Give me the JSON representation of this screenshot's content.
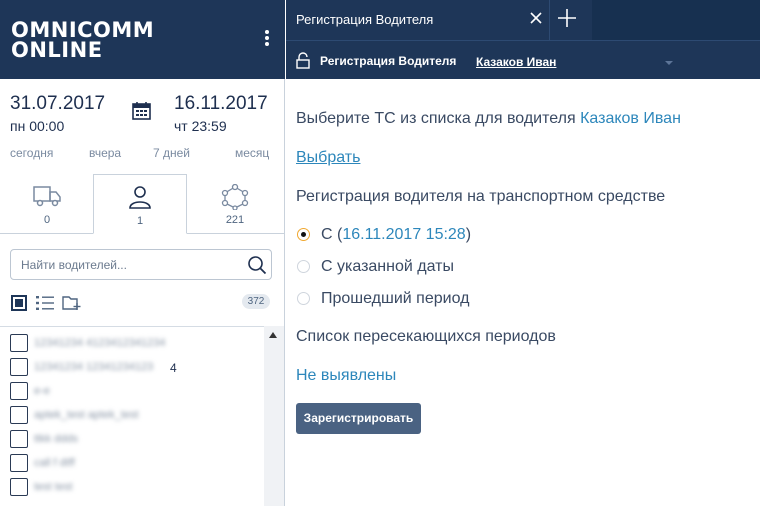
{
  "brand": {
    "line1": "OMNICOMM",
    "line2": "ONLINE"
  },
  "period": {
    "from_date": "31.07.2017",
    "from_time": "пн 00:00",
    "to_date": "16.11.2017",
    "to_time": "чт 23:59",
    "quick": [
      "сегодня",
      "вчера",
      "7 дней",
      "месяц"
    ]
  },
  "object_tabs": [
    {
      "icon": "truck-icon",
      "count": "0"
    },
    {
      "icon": "person-icon",
      "count": "1"
    },
    {
      "icon": "geozone-icon",
      "count": "221"
    }
  ],
  "search": {
    "placeholder": "Найти водителей..."
  },
  "list": {
    "count": "372",
    "rows": [
      "12341234 4123412341234",
      "12341234 12341234123",
      "4",
      "e-e",
      "aptek_test aptek_test",
      "ttkk ddds",
      "call f dtff",
      "test test"
    ]
  },
  "document_tab": {
    "title": "Регистрация Водителя"
  },
  "subheader": {
    "title": "Регистрация Водителя",
    "driver": "Казаков Иван"
  },
  "form": {
    "choose_prompt": "Выберите ТС из списка для водителя",
    "driver_name": "Казаков Иван",
    "choose_link": "Выбрать",
    "registration_heading": "Регистрация водителя на транспортном средстве",
    "options": {
      "from_now_prefix": "С (",
      "from_now_date": "16.11.2017 15:28",
      "from_now_suffix": ")",
      "from_date": "С указанной даты",
      "past_period": "Прошедший период",
      "selected_index": 0
    },
    "overlap_heading": "Список пересекающихся периодов",
    "overlap_status": "Не выявлены",
    "submit_label": "Зарегистрировать"
  },
  "colors": {
    "header_bg": "#1e3658",
    "link": "#2d87bb",
    "button_bg": "#4a6282",
    "radio_selected_ring": "#f0a830"
  }
}
